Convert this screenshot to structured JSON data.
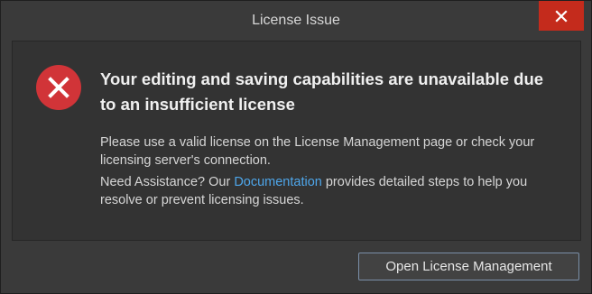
{
  "window": {
    "title": "License Issue",
    "close_icon": "close-icon"
  },
  "message": {
    "icon": "error-icon",
    "heading": "Your editing and saving capabilities are unavailable due to an insufficient license",
    "paragraph1": "Please use a valid license on the License Management page or check your licensing server's connection.",
    "paragraph2_prefix": "Need Assistance? Our ",
    "paragraph2_link": "Documentation",
    "paragraph2_suffix": " provides detailed steps to help you resolve or prevent licensing issues."
  },
  "footer": {
    "open_license_label": "Open License Management"
  },
  "colors": {
    "accent": "#4ea6ea",
    "close_button": "#c42b1c",
    "error_icon": "#d13438"
  }
}
